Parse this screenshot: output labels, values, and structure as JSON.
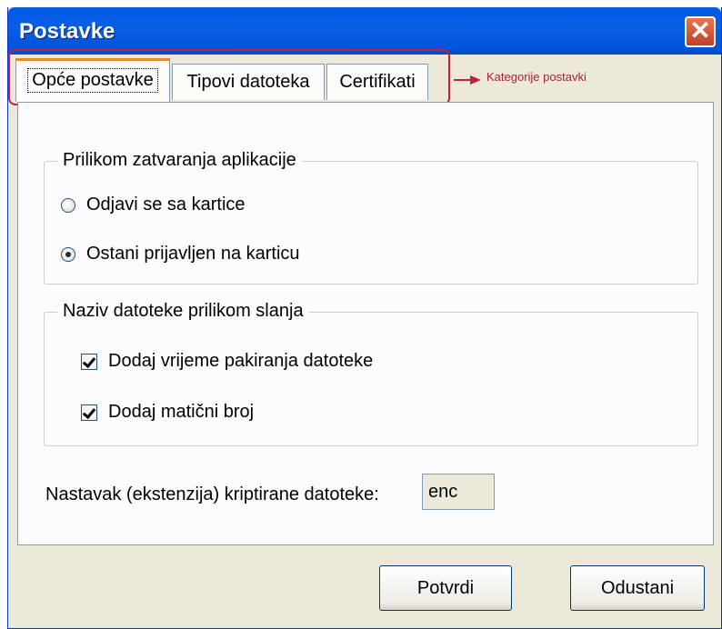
{
  "window": {
    "title": "Postavke",
    "close_symbol": "✕"
  },
  "tabs": [
    {
      "label": "Opće postavke",
      "active": true
    },
    {
      "label": "Tipovi datoteka",
      "active": false
    },
    {
      "label": "Certifikati",
      "active": false
    }
  ],
  "annotation": {
    "text": "Kategorije postavki",
    "color": "#b02030"
  },
  "closing_group": {
    "title": "Prilikom zatvaranja aplikacije",
    "options": [
      {
        "label": "Odjavi se sa kartice",
        "checked": false
      },
      {
        "label": "Ostani prijavljen na karticu",
        "checked": true
      }
    ]
  },
  "filename_group": {
    "title": "Naziv datoteke prilikom slanja",
    "options": [
      {
        "label": "Dodaj vrijeme pakiranja datoteke",
        "checked": true
      },
      {
        "label": "Dodaj matični broj",
        "checked": true
      }
    ]
  },
  "extension": {
    "label": "Nastavak (ekstenzija) kriptirane datoteke:",
    "value": "enc"
  },
  "buttons": {
    "confirm": "Potvrdi",
    "cancel": "Odustani"
  },
  "colors": {
    "titlebar": "#0254d9",
    "window_bg": "#ece9d8",
    "panel_bg": "#fcfcfe"
  }
}
